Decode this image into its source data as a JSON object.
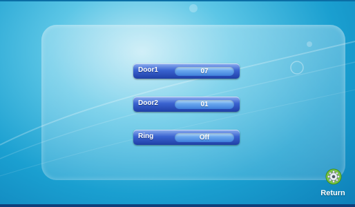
{
  "settings": {
    "rows": [
      {
        "label": "Door1",
        "value": "07"
      },
      {
        "label": "Door2",
        "value": "01"
      },
      {
        "label": "Ring",
        "value": "Off"
      }
    ]
  },
  "nav": {
    "return_label": "Return",
    "return_icon": "gear-icon"
  },
  "colors": {
    "background": "#1a9fd0",
    "row_button": "#3a63d0",
    "value_pill": "#6aa8ee"
  }
}
